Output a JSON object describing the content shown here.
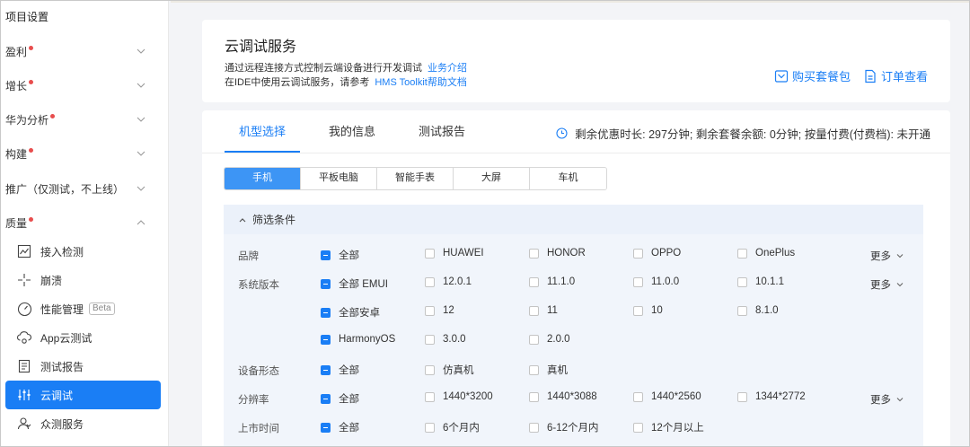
{
  "sidebar": {
    "title": "项目设置",
    "groups": [
      {
        "label": "盈利"
      },
      {
        "label": "增长"
      },
      {
        "label": "华为分析"
      },
      {
        "label": "构建"
      },
      {
        "label": "推广（仅测试，不上线）"
      },
      {
        "label": "质量"
      }
    ],
    "items": [
      {
        "label": "接入检测",
        "icon": "chart-icon"
      },
      {
        "label": "崩溃",
        "icon": "crash-icon"
      },
      {
        "label": "性能管理",
        "icon": "gauge-icon",
        "badge": "Beta"
      },
      {
        "label": "App云测试",
        "icon": "cloud-test-icon"
      },
      {
        "label": "测试报告",
        "icon": "report-icon"
      },
      {
        "label": "云调试",
        "icon": "sliders-icon",
        "active": true
      },
      {
        "label": "众测服务",
        "icon": "crowd-icon"
      }
    ]
  },
  "header": {
    "title": "云调试服务",
    "desc1": "通过远程连接方式控制云端设备进行开发调试",
    "desc1_link": "业务介绍",
    "desc2": "在IDE中使用云调试服务，请参考",
    "desc2_link": "HMS Toolkit帮助文档",
    "buy_button": "购买套餐包",
    "orders_button": "订单查看"
  },
  "tabs": [
    "机型选择",
    "我的信息",
    "测试报告"
  ],
  "quota_text": "剩余优惠时长: 297分钟;  剩余套餐余额: 0分钟;  按量付费(付费档): 未开通",
  "device_types": [
    "手机",
    "平板电脑",
    "智能手表",
    "大屏",
    "车机"
  ],
  "filter": {
    "title": "筛选条件",
    "more_label": "更多",
    "rows": {
      "brand": {
        "label": "品牌",
        "options": [
          "全部",
          "HUAWEI",
          "HONOR",
          "OPPO",
          "OnePlus"
        ]
      },
      "os1": {
        "label": "系统版本",
        "options": [
          "全部 EMUI",
          "12.0.1",
          "11.1.0",
          "11.0.0",
          "10.1.1"
        ]
      },
      "os2": {
        "options": [
          "全部安卓",
          "12",
          "11",
          "10",
          "8.1.0"
        ]
      },
      "os3": {
        "options": [
          "HarmonyOS",
          "3.0.0",
          "2.0.0"
        ]
      },
      "form": {
        "label": "设备形态",
        "options": [
          "全部",
          "仿真机",
          "真机"
        ]
      },
      "res": {
        "label": "分辨率",
        "options": [
          "全部",
          "1440*3200",
          "1440*3088",
          "1440*2560",
          "1344*2772"
        ]
      },
      "date": {
        "label": "上市时间",
        "options": [
          "全部",
          "6个月内",
          "6-12个月内",
          "12个月以上"
        ]
      }
    }
  },
  "colors": {
    "accent": "#1a7ef5",
    "red_dot": "#e84d4d"
  }
}
